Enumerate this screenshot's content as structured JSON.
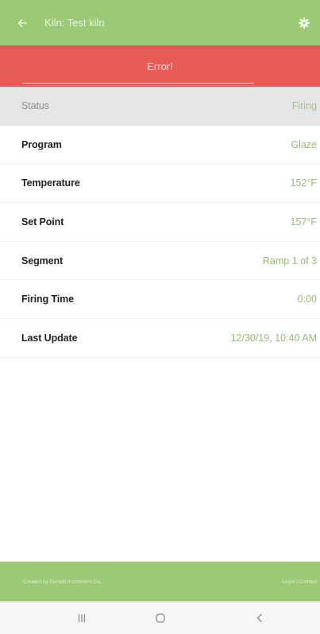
{
  "app_bar": {
    "title": "Kiln: Test kiln",
    "back_icon": "arrow-left-icon",
    "settings_icon": "gear-icon",
    "color": "#9cc976"
  },
  "error_banner": {
    "text": "Error!",
    "color": "#e85a55"
  },
  "rows": [
    {
      "label": "Status",
      "value": "Firing"
    },
    {
      "label": "Program",
      "value": "Glaze"
    },
    {
      "label": "Temperature",
      "value": "152°F"
    },
    {
      "label": "Set Point",
      "value": "157°F"
    },
    {
      "label": "Segment",
      "value": "Ramp 1 of 3"
    },
    {
      "label": "Firing Time",
      "value": "0:00"
    },
    {
      "label": "Last Update",
      "value": "12/30/19, 10:40 AM"
    }
  ],
  "footer": {
    "credit": "Created by Bartlett Instrument Co.",
    "links": "Legal | Contact"
  },
  "nav_bar": {
    "recents_icon": "recent-apps-icon",
    "home_icon": "home-circle-icon",
    "back_icon": "chevron-left-icon"
  }
}
